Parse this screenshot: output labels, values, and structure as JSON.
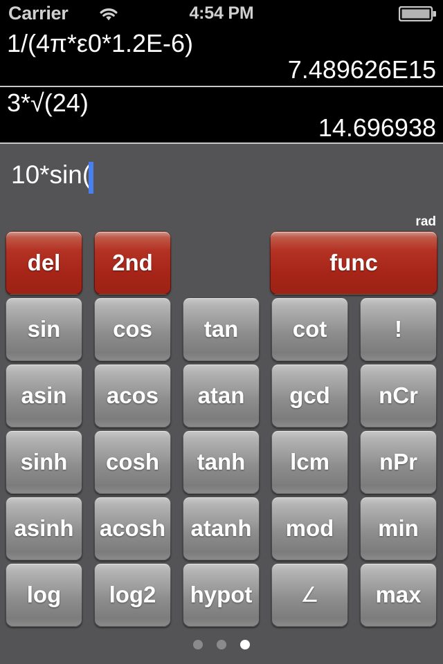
{
  "statusbar": {
    "carrier": "Carrier",
    "time": "4:54 PM",
    "wifi_icon": "wifi-icon",
    "battery_icon": "battery-icon"
  },
  "history": [
    {
      "expression": "1/(4π*ε0*1.2E-6)",
      "result": "7.489626E15"
    },
    {
      "expression": "3*√(24)",
      "result": "14.696938"
    }
  ],
  "input": {
    "expression": "10*sin(",
    "cursor": "|"
  },
  "angle_mode": "rad",
  "top_row": [
    {
      "label": "del",
      "style": "red"
    },
    {
      "label": "2nd",
      "style": "red"
    },
    {
      "label": "func",
      "style": "red"
    }
  ],
  "keys": [
    [
      "sin",
      "cos",
      "tan",
      "cot",
      "!"
    ],
    [
      "asin",
      "acos",
      "atan",
      "gcd",
      "nCr"
    ],
    [
      "sinh",
      "cosh",
      "tanh",
      "lcm",
      "nPr"
    ],
    [
      "asinh",
      "acosh",
      "atanh",
      "mod",
      "min"
    ],
    [
      "log",
      "log2",
      "hypot",
      "∠",
      "max"
    ]
  ],
  "pager": {
    "count": 3,
    "active_index": 2
  },
  "colors": {
    "background": "#545456",
    "history_bg": "#000000",
    "red_button": "#a52417",
    "gray_button": "#8e8e8e",
    "caret": "#4a7ff0",
    "text": "#ffffff"
  }
}
